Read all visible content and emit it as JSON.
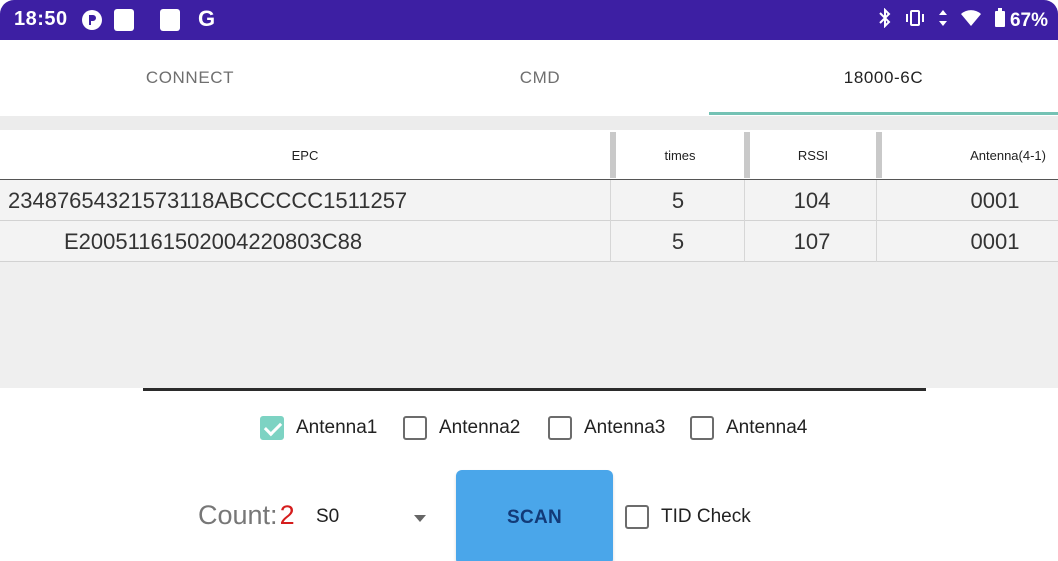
{
  "status_bar": {
    "time": "18:50",
    "battery": "67%",
    "left_icons": [
      "app-icon",
      "square-notification-icon",
      "square-notification-icon",
      "google-icon"
    ],
    "right_icons": [
      "bluetooth-icon",
      "vibrate-icon",
      "data-arrows-icon",
      "wifi-icon",
      "battery-icon"
    ],
    "accent": "#3d1fa3"
  },
  "tabs": [
    {
      "label": "CONNECT",
      "active": false
    },
    {
      "label": "CMD",
      "active": false
    },
    {
      "label": "18000-6C",
      "active": true
    }
  ],
  "table": {
    "columns": [
      "EPC",
      "times",
      "RSSI",
      "Antenna(4-1)"
    ],
    "rows": [
      {
        "epc": "23487654321573118ABCCCCC1511257",
        "times": "5",
        "rssi": "104",
        "antenna": "0001"
      },
      {
        "epc": "E2005116150200422 0803C88",
        "times": "5",
        "rssi": "107",
        "antenna": "0001"
      }
    ]
  },
  "antennas": [
    {
      "label": "Antenna1",
      "checked": true
    },
    {
      "label": "Antenna2",
      "checked": false
    },
    {
      "label": "Antenna3",
      "checked": false
    },
    {
      "label": "Antenna4",
      "checked": false
    }
  ],
  "controls": {
    "count_label": "Count:",
    "count_value": "2",
    "session_value": "S0",
    "scan_label": "SCAN",
    "tid_label": "TID Check",
    "tid_checked": false
  },
  "colors": {
    "tab_indicator": "#74c2b4",
    "checkbox_on": "#7dd3c3",
    "scan_button": "#4aa6ea",
    "count_value": "#d51d1d"
  }
}
